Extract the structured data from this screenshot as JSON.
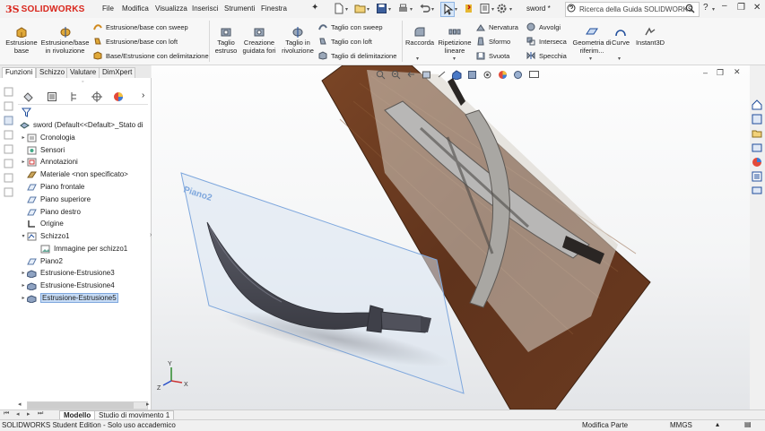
{
  "title_bar": {
    "logo_prefix": "3S",
    "logo_text": "SOLIDWORKS",
    "menus": [
      "File",
      "Modifica",
      "Visualizza",
      "Inserisci",
      "Strumenti",
      "Finestra"
    ],
    "document_name": "sword *",
    "search_placeholder": "Ricerca della Guida SOLIDWORKS"
  },
  "ribbon": {
    "extrude_boss": "Estrusione base",
    "revolve_boss": "Estrusione/base in rivoluzione",
    "swept_boss": "Estrusione/base con sweep",
    "lofted_boss": "Estrusione/base con loft",
    "boundary_boss": "Base/Estrusione con delimitazione",
    "extruded_cut": "Taglio estruso",
    "hole_wizard": "Creazione guidata fori",
    "revolved_cut": "Taglio in rivoluzione",
    "swept_cut": "Taglio con sweep",
    "lofted_cut": "Taglio con loft",
    "boundary_cut": "Taglio di delimitazione",
    "fillet": "Raccorda",
    "linear_pattern": "Ripetizione lineare",
    "rib": "Nervatura",
    "draft": "Sformo",
    "shell": "Svuota",
    "wrap": "Avvolgi",
    "intersect": "Interseca",
    "mirror": "Specchia",
    "reference_geometry": "Geometria di riferim...",
    "curves": "Curve",
    "instant3d": "Instant3D"
  },
  "tabs": [
    "Funzioni",
    "Schizzo",
    "Valutare",
    "DimXpert"
  ],
  "feature_tree": {
    "root": "sword  (Default<<Default>_Stato di",
    "items": [
      {
        "label": "Cronologia",
        "icon": "history-icon"
      },
      {
        "label": "Sensori",
        "icon": "sensor-icon"
      },
      {
        "label": "Annotazioni",
        "icon": "annotation-icon"
      },
      {
        "label": "Materiale <non specificato>",
        "icon": "material-icon"
      },
      {
        "label": "Piano frontale",
        "icon": "plane-icon"
      },
      {
        "label": "Piano superiore",
        "icon": "plane-icon"
      },
      {
        "label": "Piano destro",
        "icon": "plane-icon"
      },
      {
        "label": "Origine",
        "icon": "origin-icon"
      },
      {
        "label": "Schizzo1",
        "icon": "sketch-icon"
      },
      {
        "label": "Immagine per schizzo1",
        "icon": "image-icon"
      },
      {
        "label": "Piano2",
        "icon": "plane-icon"
      },
      {
        "label": "Estrusione-Estrusione3",
        "icon": "extrude-icon"
      },
      {
        "label": "Estrusione-Estrusione4",
        "icon": "extrude-icon"
      },
      {
        "label": "Estrusione-Estrusione5",
        "icon": "extrude-icon"
      }
    ]
  },
  "viewport": {
    "plane_label": "Piano2",
    "axis_labels": [
      "Y",
      "X",
      "Z"
    ]
  },
  "bottom_tabs": [
    "Modello",
    "Studio di movimento 1"
  ],
  "status_bar": {
    "edition": "SOLIDWORKS Student Edition - Solo uso accademico",
    "mode": "Modifica Parte",
    "units": "MMGS"
  },
  "colors": {
    "brand_red": "#d9261c",
    "selection_blue": "#c6dbf5",
    "plane_blue": "#7ea7dd",
    "wood_brown": "#6e3f22",
    "blade_gray": "#4b4c55"
  }
}
